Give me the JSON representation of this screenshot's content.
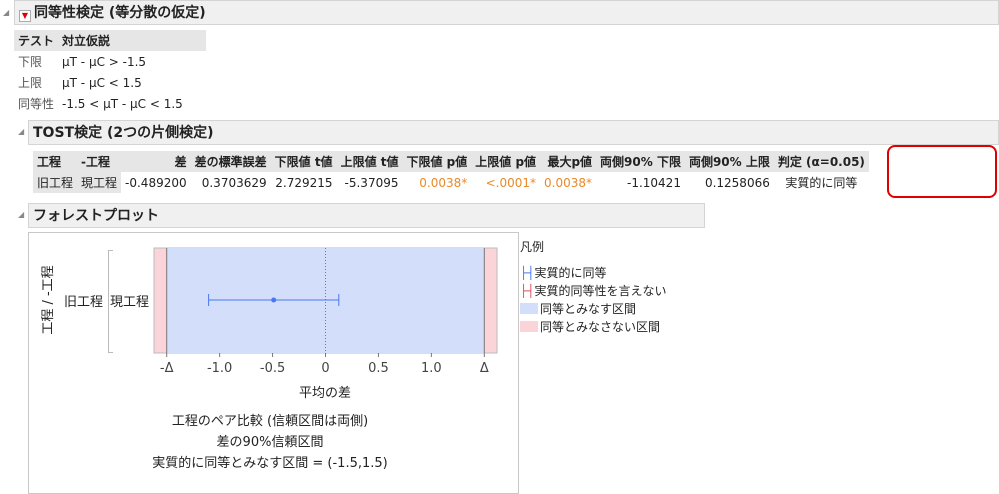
{
  "equiv": {
    "title": "同等性検定 (等分散の仮定)",
    "headers": [
      "テスト",
      "対立仮説"
    ],
    "rows": [
      [
        "下限",
        "μT - μC > -1.5"
      ],
      [
        "上限",
        "μT - μC < 1.5"
      ],
      [
        "同等性",
        "-1.5 < μT - μC < 1.5"
      ]
    ]
  },
  "tost": {
    "title": "TOST検定 (2つの片側検定)",
    "headers": [
      "工程",
      "-工程",
      "差",
      "差の標準誤差",
      "下限値 t値",
      "上限値 t値",
      "下限値 p値",
      "上限値 p値",
      "最大p値",
      "両側90% 下限",
      "両側90% 上限",
      "判定 (α=0.05)"
    ],
    "rows": [
      [
        "旧工程",
        "現工程",
        "-0.489200",
        "0.3703629",
        "2.729215",
        "-5.37095",
        "0.0038*",
        "<.0001*",
        "0.0038*",
        "-1.10421",
        "0.1258066",
        "実質的に同等"
      ]
    ],
    "highlight_color": "#e00000",
    "pvalue_color": "#e88a2a"
  },
  "forest": {
    "title": "フォレストプロット",
    "y_axis_label": "工程 / -工程",
    "row_label_1": "旧工程",
    "row_label_2": "現工程",
    "x_axis_label": "平均の差",
    "tick_labels": [
      "-Δ",
      "-1.0",
      "-0.5",
      "0",
      "0.5",
      "1.0",
      "Δ"
    ],
    "caption1": "工程のペア比較 (信頼区間は両側)",
    "caption2": "差の90%信頼区間",
    "caption3": "実質的に同等とみなす区間 = (-1.5,1.5)",
    "legend": {
      "title": "凡例",
      "items": [
        "実質的に同等",
        "実質的同等性を言えない",
        "同等とみなす区間",
        "同等とみなさない区間"
      ]
    },
    "colors": {
      "equiv": "#4a78f0",
      "not_equiv": "#e05060",
      "equiv_region": "#d3defa",
      "not_region": "#fad4d8"
    }
  },
  "chart_data": {
    "type": "forest",
    "estimate": -0.4892,
    "ci": [
      -1.10421,
      0.1258066
    ],
    "delta": 1.5,
    "ticks": [
      -1.5,
      -1.0,
      -0.5,
      0,
      0.5,
      1.0,
      1.5
    ],
    "xlim": [
      -1.62,
      1.62
    ]
  }
}
